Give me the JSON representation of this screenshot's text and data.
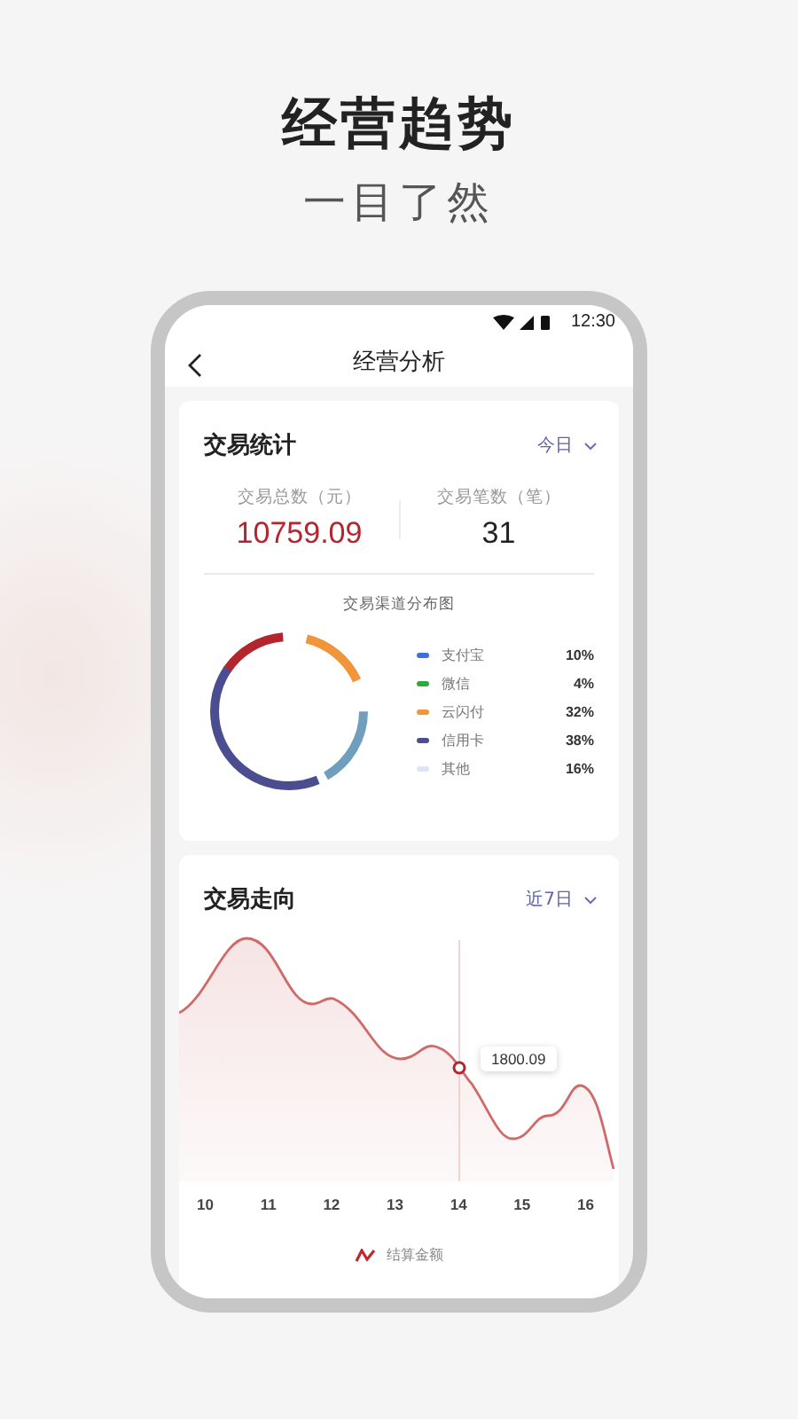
{
  "headline": "经营趋势",
  "subheadline": "一目了然",
  "status_bar": {
    "time": "12:30"
  },
  "nav": {
    "title": "经营分析"
  },
  "stats_card": {
    "title": "交易统计",
    "period": "今日",
    "metrics": [
      {
        "label": "交易总数（元）",
        "value": "10759.09",
        "kind": "amount"
      },
      {
        "label": "交易笔数（笔）",
        "value": "31",
        "kind": "count"
      }
    ],
    "channel_chart": {
      "title": "交易渠道分布图",
      "legend": [
        {
          "name": "支付宝",
          "share": "10%",
          "color": "#3d6fe0"
        },
        {
          "name": "微信",
          "share": "4%",
          "color": "#2eaa3c"
        },
        {
          "name": "云闪付",
          "share": "32%",
          "color": "#f0953a"
        },
        {
          "name": "信用卡",
          "share": "38%",
          "color": "#4a4d8f"
        },
        {
          "name": "其他",
          "share": "16%",
          "color": "#dde5f7"
        }
      ]
    }
  },
  "trend_card": {
    "title": "交易走向",
    "period": "近7日",
    "x_labels": [
      "10",
      "11",
      "12",
      "13",
      "14",
      "15",
      "16"
    ],
    "tooltip": "1800.09",
    "legend": "结算金额"
  }
}
